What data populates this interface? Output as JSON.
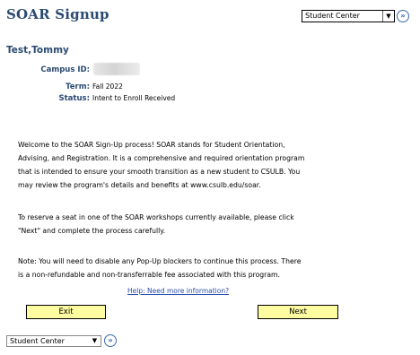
{
  "header": {
    "title": "SOAR Signup",
    "nav_select_value": "Student Center",
    "go_icon": "double-chevron-right-icon"
  },
  "student": {
    "name": "Test,Tommy",
    "campus_id_label": "Campus ID:",
    "term_label": "Term:",
    "term_value": "Fall 2022",
    "status_label": "Status:",
    "status_value": "Intent to Enroll Received"
  },
  "content": {
    "paragraph1_lines": [
      "Welcome to the SOAR Sign-Up process! SOAR stands for Student Orientation,",
      "Advising, and Registration. It is a comprehensive and required orientation program",
      "that is intended to ensure your smooth transition as a new student to CSULB. You",
      "may review the program's details and benefits at www.csulb.edu/soar."
    ],
    "paragraph2_lines": [
      "To reserve a seat in one of the SOAR workshops currently available, please click",
      "\"Next\" and complete the process carefully."
    ],
    "paragraph3_lines": [
      "Note: You will need to disable any Pop-Up blockers to continue this process. There",
      "is a non-refundable and non-transferrable fee associated with this program."
    ],
    "help_link": "Help: Need more information?"
  },
  "buttons": {
    "exit_label": "Exit",
    "next_label": "Next",
    "button_color": "#fdfca0"
  },
  "footer": {
    "nav_select_value": "Student Center"
  },
  "colors": {
    "title": "#2b4a72",
    "link": "#2c4fb0"
  }
}
